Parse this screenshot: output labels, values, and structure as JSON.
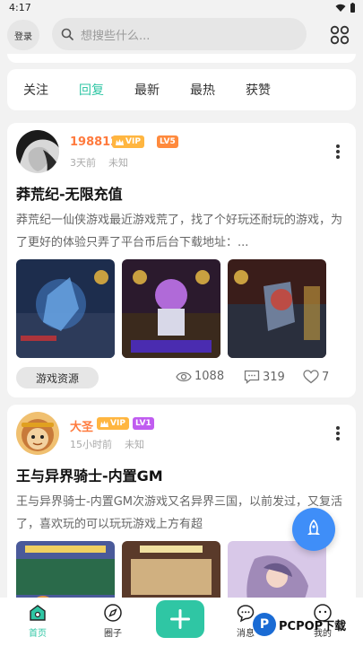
{
  "status": {
    "time": "4:17"
  },
  "header": {
    "login_label": "登录",
    "search_placeholder": "想搜些什么..."
  },
  "tabs": [
    {
      "label": "关注",
      "active": false
    },
    {
      "label": "回复",
      "active": true
    },
    {
      "label": "最新",
      "active": false
    },
    {
      "label": "最热",
      "active": false
    },
    {
      "label": "获赞",
      "active": false
    }
  ],
  "posts": [
    {
      "username": "198812",
      "vip_label": "VIP",
      "level_label": "LV5",
      "time_ago": "3天前",
      "location": "未知",
      "title": "莽荒纪-无限充值",
      "excerpt": "莽荒纪一仙侠游戏最近游戏荒了，找了个好玩还耐玩的游戏，为了更好的体验只弄了平台币后台下载地址：...",
      "tag": "游戏资源",
      "views": "1088",
      "comments": "319",
      "likes": "7"
    },
    {
      "username": "大圣",
      "vip_label": "VIP",
      "level_label": "LV1",
      "time_ago": "15小时前",
      "location": "未知",
      "title": "王与异界骑士-内置GM",
      "excerpt": "王与异界骑士-内置GM次游戏又名异界三国，以前发过，又复活了，喜欢玩的可以玩玩游戏上方有超"
    }
  ],
  "bottom_nav": {
    "home": "首页",
    "circle": "圈子",
    "messages": "消息",
    "mine": "我的"
  },
  "watermark": {
    "logo_letter": "P",
    "text": "PCPOP下载"
  },
  "colors": {
    "accent": "#2fc6a4",
    "username": "#ff7a3d",
    "vip": "#ffb640",
    "lv5": "#ff8a3d",
    "lv1": "#c05cf0",
    "fab": "#3f8ef8"
  }
}
